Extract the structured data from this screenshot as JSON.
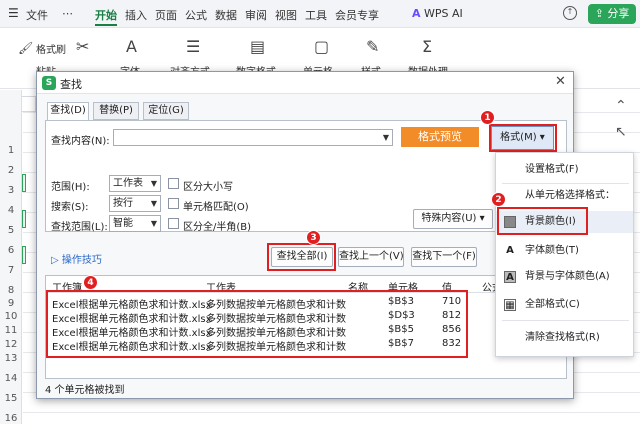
{
  "topbar": {
    "menu": [
      "文件",
      "开始",
      "插入",
      "页面",
      "公式",
      "数据",
      "审阅",
      "视图",
      "工具",
      "会员专享"
    ],
    "active": "开始",
    "ai_label": "WPS AI",
    "share_label": "分享"
  },
  "ribbon": {
    "format_painter": "格式刷",
    "paste": "粘贴",
    "font": "字体",
    "align": "对齐方式",
    "number_format": "数字格式",
    "cells": "单元格",
    "style": "样式",
    "data_process": "数据处理"
  },
  "sheet": {
    "row_numbers": [
      "1",
      "2",
      "3",
      "4",
      "5",
      "6",
      "7",
      "8",
      "9",
      "10",
      "11",
      "12",
      "13",
      "14",
      "15",
      "16"
    ]
  },
  "dialog": {
    "logo": "S",
    "title": "查找",
    "tabs": [
      "查找(D)",
      "替换(P)",
      "定位(G)"
    ],
    "find_content_label": "查找内容(N):",
    "find_value": "",
    "format_preview": "格式预览",
    "format_button": "格式(M) ▾",
    "scope_label": "范围(H):",
    "scope_value": "工作表",
    "search_label": "搜索(S):",
    "search_value": "按行",
    "lookin_label": "查找范围(L):",
    "lookin_value": "智能",
    "match_case": "区分大小写",
    "match_cell": "单元格匹配(O)",
    "match_width": "区分全/半角(B)",
    "special_content": "特殊内容(U) ▾",
    "tips": "操作技巧",
    "find_all": "查找全部(I)",
    "find_prev": "查找上一个(V)",
    "find_next": "查找下一个(F)",
    "results": {
      "headers": [
        "工作簿",
        "工作表",
        "名称",
        "单元格",
        "值",
        "公式"
      ],
      "rows": [
        [
          "Excel根据单元格颜色求和计数.xlsx",
          "多列数据按单元格颜色求和计数",
          "",
          "$B$3",
          "710"
        ],
        [
          "Excel根据单元格颜色求和计数.xlsx",
          "多列数据按单元格颜色求和计数",
          "",
          "$D$3",
          "812"
        ],
        [
          "Excel根据单元格颜色求和计数.xlsx",
          "多列数据按单元格颜色求和计数",
          "",
          "$B$5",
          "856"
        ],
        [
          "Excel根据单元格颜色求和计数.xlsx",
          "多列数据按单元格颜色求和计数",
          "",
          "$B$7",
          "832"
        ]
      ]
    },
    "status": "4 个单元格被找到"
  },
  "popup_menu": {
    "items": [
      "设置格式(F)",
      "从单元格选择格式：",
      "背景颜色(I)",
      "字体颜色(T)",
      "背景与字体颜色(A)",
      "全部格式(C)",
      "清除查找格式(R)"
    ]
  },
  "badges": [
    "1",
    "2",
    "3",
    "4"
  ],
  "colors": {
    "accent_green": "#2aa55a",
    "highlight_red": "#e02020",
    "preview_orange": "#f28c28",
    "link_blue": "#2a68c8"
  }
}
